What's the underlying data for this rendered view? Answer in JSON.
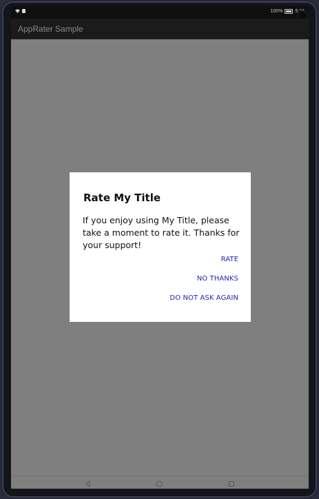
{
  "status_bar": {
    "battery_text": "100%",
    "time": "5:24"
  },
  "app_bar": {
    "title": "AppRater Sample"
  },
  "dialog": {
    "title": "Rate My Title",
    "message": "If you enjoy using My Title, please take a moment to rate it. Thanks for your support!",
    "buttons": {
      "rate": "RATE",
      "no_thanks": "NO THANKS",
      "do_not_ask_again": "DO NOT ASK AGAIN"
    },
    "button_color": "#1f1fb4"
  },
  "nav_bar": {
    "icons": [
      "back-icon",
      "home-icon",
      "recents-icon"
    ]
  },
  "colors": {
    "scrim": "#7f7f7f",
    "app_bar": "#1b1b1b",
    "dialog_bg": "#ffffff"
  }
}
